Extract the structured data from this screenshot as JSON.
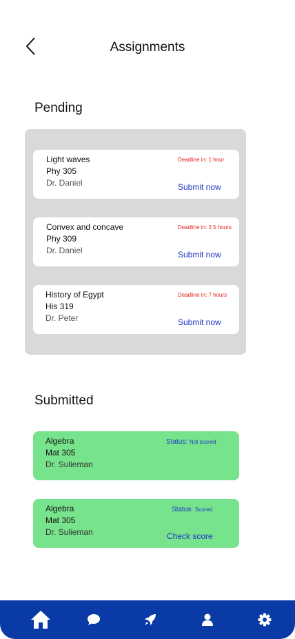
{
  "header": {
    "title": "Assignments",
    "back_icon": "chevron-left-icon"
  },
  "pending": {
    "section_title": "Pending",
    "items": [
      {
        "title": "Light waves",
        "course": "Phy 305",
        "instructor": "Dr. Daniel",
        "deadline": "Deadline in: 1 hour",
        "action": "Submit now"
      },
      {
        "title": "Convex and concave",
        "course": "Phy 309",
        "instructor": "Dr. Daniel",
        "deadline": "Deadline in: 2.5 hours",
        "action": "Submit now"
      },
      {
        "title": "History of Egypt",
        "course": "His 319",
        "instructor": "Dr. Peter",
        "deadline": "Deadline in: 7 hours",
        "action": "Submit now"
      }
    ]
  },
  "submitted": {
    "section_title": "Submitted",
    "items": [
      {
        "title": "Algebra",
        "course": "Mat 305",
        "instructor": "Dr. Sulieman",
        "status_label": "Status:",
        "status_value": "Not scored"
      },
      {
        "title": "Algebra",
        "course": "Mat 305",
        "instructor": "Dr. Sulieman",
        "status_label": "Status:",
        "status_value": "Scored",
        "action": "Check score"
      }
    ]
  },
  "nav": {
    "items": [
      "home-icon",
      "chat-icon",
      "rocket-icon",
      "profile-icon",
      "settings-icon"
    ]
  },
  "colors": {
    "nav_bg": "#0a3aa6",
    "deadline": "#e0201c",
    "link": "#1f36c7",
    "submitted_card": "#77e38c",
    "pending_panel": "#d9d9d9"
  }
}
